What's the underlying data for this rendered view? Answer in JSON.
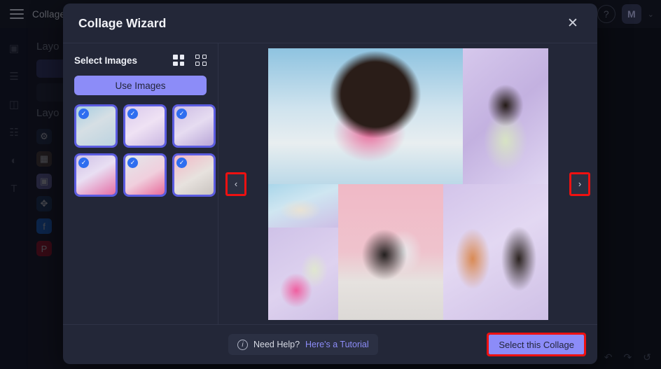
{
  "background_app": {
    "topbar": {
      "menu_icon": "hamburger-icon",
      "title": "Collage M",
      "help_icon": "?",
      "avatar_initial": "M",
      "chevron": "⌄"
    },
    "left_rail_icons": [
      "image-icon",
      "sliders-icon",
      "layout-icon",
      "list-icon",
      "shapes-icon",
      "text-icon"
    ],
    "panel": {
      "section_1_title": "Layo",
      "section_2_title": "Layo",
      "small_icons": [
        "settings-icon",
        "grid-icon",
        "frame-icon",
        "drag-icon",
        "facebook-icon",
        "pinterest-icon"
      ]
    },
    "bottom_right_icons": [
      "undo-icon",
      "redo-icon",
      "history-icon"
    ]
  },
  "modal": {
    "title": "Collage Wizard",
    "close_label": "✕",
    "left_panel": {
      "heading": "Select Images",
      "view_toggle_4": "grid-4-icon",
      "view_toggle_9": "grid-9-icon",
      "use_images_label": "Use Images",
      "thumbnails": [
        {
          "id": 1,
          "selected": true,
          "check": "✓",
          "style": "ph-t1"
        },
        {
          "id": 2,
          "selected": true,
          "check": "✓",
          "style": "ph-t2"
        },
        {
          "id": 3,
          "selected": true,
          "check": "✓",
          "style": "ph-t3"
        },
        {
          "id": 4,
          "selected": true,
          "check": "✓",
          "style": "ph-t4"
        },
        {
          "id": 5,
          "selected": true,
          "check": "✓",
          "style": "ph-t5"
        },
        {
          "id": 6,
          "selected": true,
          "check": "✓",
          "style": "ph-t6"
        }
      ]
    },
    "preview": {
      "prev_label": "‹",
      "next_label": "›",
      "cells": [
        {
          "id": "top-left",
          "style": "ph1"
        },
        {
          "id": "top-right",
          "style": "ph2"
        },
        {
          "id": "bottom-left-upper",
          "style": "ph3"
        },
        {
          "id": "bottom-left-lower",
          "style": "ph4"
        },
        {
          "id": "bottom-center",
          "style": "ph5"
        },
        {
          "id": "bottom-right",
          "style": "ph6"
        }
      ]
    },
    "footer": {
      "info_icon": "i",
      "help_text": "Need Help?",
      "help_link": "Here's a Tutorial",
      "select_label": "Select this Collage"
    }
  },
  "colors": {
    "accent": "#8c8cf8",
    "modal_bg": "#232738",
    "highlight_box": "#ee1111",
    "check_badge": "#2f6ef0",
    "thumb_border": "#5b5ce0"
  }
}
